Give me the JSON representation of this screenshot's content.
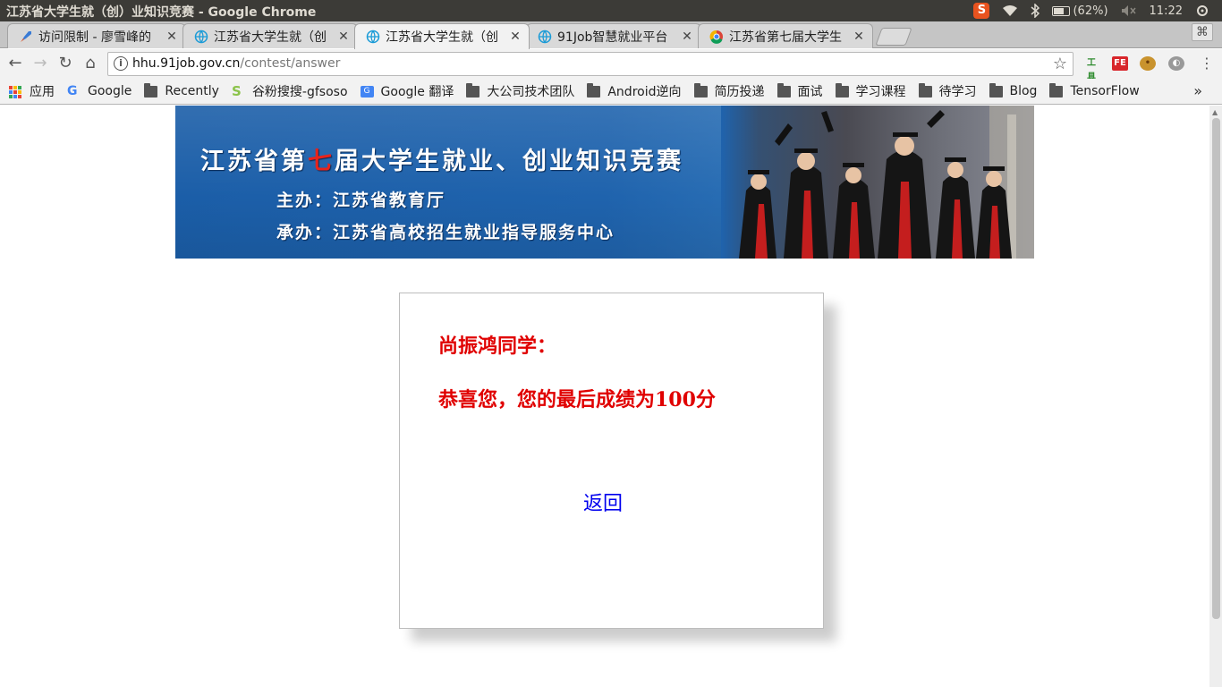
{
  "system_bar": {
    "window_title": "江苏省大学生就（创）业知识竞赛 - Google Chrome",
    "battery": "(62%)",
    "time": "11:22"
  },
  "tabs": [
    {
      "label": "访问限制 - 廖雪峰的"
    },
    {
      "label": "江苏省大学生就（创"
    },
    {
      "label": "江苏省大学生就（创",
      "active": true
    },
    {
      "label": "91Job智慧就业平台"
    },
    {
      "label": "江苏省第七届大学生"
    }
  ],
  "address_bar": {
    "host": "hhu.91job.gov.cn",
    "path": "/contest/answer"
  },
  "bookmarks": [
    {
      "label": "应用",
      "icon": "apps-icon"
    },
    {
      "label": "Google",
      "icon": "google-icon"
    },
    {
      "label": "Recently",
      "icon": "folder-icon"
    },
    {
      "label": "谷粉搜搜-gfsoso",
      "icon": "gfsoso-icon"
    },
    {
      "label": "Google 翻译",
      "icon": "translate-icon"
    },
    {
      "label": "大公司技术团队",
      "icon": "folder-icon"
    },
    {
      "label": "Android逆向",
      "icon": "folder-icon"
    },
    {
      "label": "简历投递",
      "icon": "folder-icon"
    },
    {
      "label": "面试",
      "icon": "folder-icon"
    },
    {
      "label": "学习课程",
      "icon": "folder-icon"
    },
    {
      "label": "待学习",
      "icon": "folder-icon"
    },
    {
      "label": "Blog",
      "icon": "folder-icon"
    },
    {
      "label": "TensorFlow",
      "icon": "folder-icon"
    }
  ],
  "banner": {
    "headline_part1": "江苏省第",
    "headline_red": "七",
    "headline_part2": "届大学生就业、创业知识竞赛",
    "organizer": "主办：江苏省教育厅",
    "undertaker": "承办：江苏省高校招生就业指导服务中心"
  },
  "result_card": {
    "greeting": "尚振鸿同学：",
    "result_text": "恭喜您，您的最后成绩为100分",
    "back_link": "返回"
  }
}
